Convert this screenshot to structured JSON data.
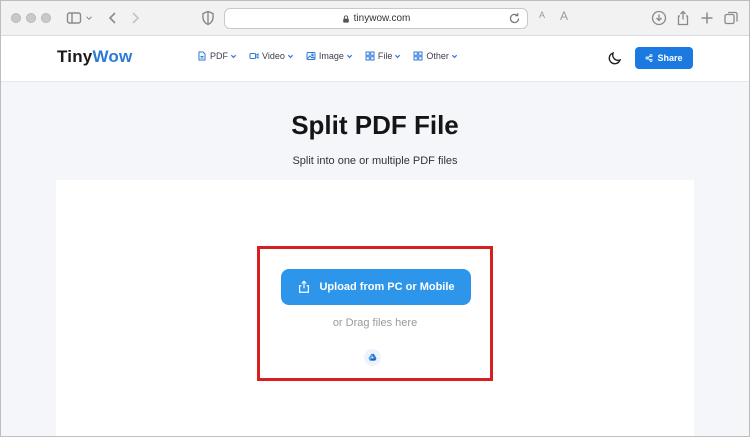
{
  "browser": {
    "url": "tinywow.com",
    "reader_small": "A",
    "reader_large": "A"
  },
  "header": {
    "logo_part1": "Tiny",
    "logo_part2": "Wow",
    "nav": [
      {
        "label": "PDF",
        "icon": "pdf-icon"
      },
      {
        "label": "Video",
        "icon": "video-icon"
      },
      {
        "label": "Image",
        "icon": "image-icon"
      },
      {
        "label": "File",
        "icon": "file-icon"
      },
      {
        "label": "Other",
        "icon": "other-icon"
      }
    ],
    "share_label": "Share"
  },
  "main": {
    "title": "Split PDF File",
    "subtitle": "Split into one or multiple PDF files",
    "upload_label": "Upload from PC or Mobile",
    "drag_text": "or Drag files here"
  },
  "colors": {
    "accent": "#2b7ad9",
    "upload_button": "#2d96ea",
    "highlight": "#d81e1e"
  }
}
